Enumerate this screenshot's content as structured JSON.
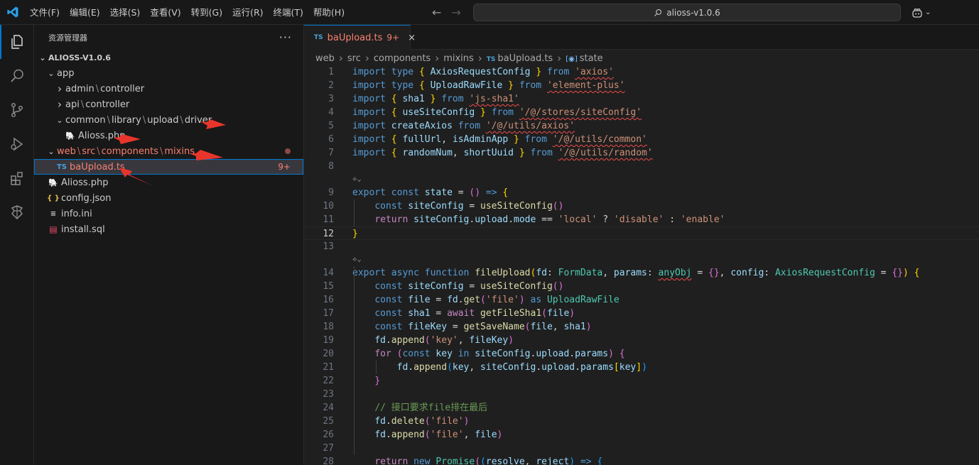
{
  "titlebar": {
    "menu": [
      "文件(F)",
      "编辑(E)",
      "选择(S)",
      "查看(V)",
      "转到(G)",
      "运行(R)",
      "终端(T)",
      "帮助(H)"
    ],
    "search_text": "alioss-v1.0.6"
  },
  "sidebar": {
    "title": "资源管理器",
    "more": "···",
    "root": "ALIOSS-V1.0.6",
    "tree": [
      {
        "depth": 1,
        "chevron": "v",
        "parts": [
          "app"
        ]
      },
      {
        "depth": 2,
        "chevron": ">",
        "parts": [
          "admin",
          "controller"
        ]
      },
      {
        "depth": 2,
        "chevron": ">",
        "parts": [
          "api",
          "controller"
        ]
      },
      {
        "depth": 2,
        "chevron": "v",
        "parts": [
          "common",
          "library",
          "upload",
          "driver"
        ]
      },
      {
        "depth": 3,
        "icon": "php",
        "parts": [
          "Alioss.php"
        ]
      },
      {
        "depth": 1,
        "chevron": "v",
        "parts": [
          "web",
          "src",
          "components",
          "mixins"
        ],
        "red": true,
        "dot": true
      },
      {
        "depth": 2,
        "icon": "ts",
        "parts": [
          "baUpload.ts"
        ],
        "red": true,
        "badge": "9+",
        "selected": true
      },
      {
        "depth": 1,
        "icon": "php",
        "parts": [
          "Alioss.php"
        ]
      },
      {
        "depth": 1,
        "icon": "json",
        "parts": [
          "config.json"
        ]
      },
      {
        "depth": 1,
        "icon": "ini",
        "parts": [
          "info.ini"
        ]
      },
      {
        "depth": 1,
        "icon": "sql",
        "parts": [
          "install.sql"
        ]
      }
    ]
  },
  "editor": {
    "tab": {
      "icon_text": "TS",
      "label": "baUpload.ts",
      "count": "9+",
      "close": "×"
    },
    "breadcrumb": [
      "web",
      "src",
      "components",
      "mixins"
    ],
    "breadcrumb_file": "baUpload.ts",
    "breadcrumb_file_icon": "TS",
    "breadcrumb_symbol": "state",
    "lines": [
      {
        "n": "1",
        "t": [
          [
            "kw",
            "import "
          ],
          [
            "kw",
            "type "
          ],
          [
            "b1",
            "{ "
          ],
          [
            "vr",
            "AxiosRequestConfig "
          ],
          [
            "b1",
            "} "
          ],
          [
            "kw",
            "from "
          ],
          [
            "st~",
            "'axios'"
          ]
        ]
      },
      {
        "n": "2",
        "t": [
          [
            "kw",
            "import "
          ],
          [
            "kw",
            "type "
          ],
          [
            "b1",
            "{ "
          ],
          [
            "vr",
            "UploadRawFile "
          ],
          [
            "b1",
            "} "
          ],
          [
            "kw",
            "from "
          ],
          [
            "st~",
            "'element-plus'"
          ]
        ]
      },
      {
        "n": "3",
        "t": [
          [
            "kw",
            "import "
          ],
          [
            "b1",
            "{ "
          ],
          [
            "vr",
            "sha1 "
          ],
          [
            "b1",
            "} "
          ],
          [
            "kw",
            "from "
          ],
          [
            "st~",
            "'js-sha1'"
          ]
        ]
      },
      {
        "n": "4",
        "t": [
          [
            "kw",
            "import "
          ],
          [
            "b1",
            "{ "
          ],
          [
            "vr",
            "useSiteConfig "
          ],
          [
            "b1",
            "} "
          ],
          [
            "kw",
            "from "
          ],
          [
            "st~",
            "'/@/stores/siteConfig'"
          ]
        ]
      },
      {
        "n": "5",
        "t": [
          [
            "kw",
            "import "
          ],
          [
            "vr",
            "createAxios "
          ],
          [
            "kw",
            "from "
          ],
          [
            "st~",
            "'/@/utils/axios'"
          ]
        ]
      },
      {
        "n": "6",
        "t": [
          [
            "kw",
            "import "
          ],
          [
            "b1",
            "{ "
          ],
          [
            "vr",
            "fullUrl"
          ],
          [
            "pl",
            ", "
          ],
          [
            "vr",
            "isAdminApp "
          ],
          [
            "b1",
            "} "
          ],
          [
            "kw",
            "from "
          ],
          [
            "st~",
            "'/@/utils/common'"
          ]
        ]
      },
      {
        "n": "7",
        "t": [
          [
            "kw",
            "import "
          ],
          [
            "b1",
            "{ "
          ],
          [
            "vr",
            "randomNum"
          ],
          [
            "pl",
            ", "
          ],
          [
            "vr",
            "shortUuid "
          ],
          [
            "b1",
            "} "
          ],
          [
            "kw",
            "from "
          ],
          [
            "st~",
            "'/@/utils/random'"
          ]
        ]
      },
      {
        "n": "8",
        "t": []
      },
      {
        "n": "9",
        "t": [
          [
            "kw",
            "export "
          ],
          [
            "kw",
            "const "
          ],
          [
            "vr",
            "state "
          ],
          [
            "pl",
            "= "
          ],
          [
            "b2",
            "() "
          ],
          [
            "kw",
            "=> "
          ],
          [
            "b1",
            "{"
          ]
        ],
        "lens": true
      },
      {
        "n": "10",
        "t": [
          [
            "pl",
            "    "
          ],
          [
            "kw",
            "const "
          ],
          [
            "vr",
            "siteConfig "
          ],
          [
            "pl",
            "= "
          ],
          [
            "fn",
            "useSiteConfig"
          ],
          [
            "b2",
            "()"
          ]
        ]
      },
      {
        "n": "11",
        "t": [
          [
            "pl",
            "    "
          ],
          [
            "ck",
            "return "
          ],
          [
            "vr",
            "siteConfig"
          ],
          [
            "pl",
            "."
          ],
          [
            "vr",
            "upload"
          ],
          [
            "pl",
            "."
          ],
          [
            "vr",
            "mode "
          ],
          [
            "pl",
            "== "
          ],
          [
            "st",
            "'local' "
          ],
          [
            "pl",
            "? "
          ],
          [
            "st",
            "'disable' "
          ],
          [
            "pl",
            ": "
          ],
          [
            "st",
            "'enable'"
          ]
        ]
      },
      {
        "n": "12",
        "t": [
          [
            "b1",
            "}"
          ]
        ],
        "current": true
      },
      {
        "n": "13",
        "t": []
      },
      {
        "n": "14",
        "t": [
          [
            "kw",
            "export "
          ],
          [
            "kw",
            "async "
          ],
          [
            "kw",
            "function "
          ],
          [
            "fn",
            "fileUpload"
          ],
          [
            "b1",
            "("
          ],
          [
            "vr",
            "fd"
          ],
          [
            "pl",
            ": "
          ],
          [
            "ty",
            "FormData"
          ],
          [
            "pl",
            ", "
          ],
          [
            "vr",
            "params"
          ],
          [
            "pl",
            ": "
          ],
          [
            "ty~",
            "anyObj"
          ],
          [
            "pl",
            " = "
          ],
          [
            "b2",
            "{}"
          ],
          [
            "pl",
            ", "
          ],
          [
            "vr",
            "config"
          ],
          [
            "pl",
            ": "
          ],
          [
            "ty",
            "AxiosRequestConfig "
          ],
          [
            "pl",
            "= "
          ],
          [
            "b2",
            "{}"
          ],
          [
            "b1",
            ")"
          ],
          [
            "pl",
            " "
          ],
          [
            "b1",
            "{"
          ]
        ],
        "lens": true
      },
      {
        "n": "15",
        "t": [
          [
            "pl",
            "    "
          ],
          [
            "kw",
            "const "
          ],
          [
            "vr",
            "siteConfig "
          ],
          [
            "pl",
            "= "
          ],
          [
            "fn",
            "useSiteConfig"
          ],
          [
            "b2",
            "()"
          ]
        ]
      },
      {
        "n": "16",
        "t": [
          [
            "pl",
            "    "
          ],
          [
            "kw",
            "const "
          ],
          [
            "vr",
            "file "
          ],
          [
            "pl",
            "= "
          ],
          [
            "vr",
            "fd"
          ],
          [
            "pl",
            "."
          ],
          [
            "fn",
            "get"
          ],
          [
            "b2",
            "("
          ],
          [
            "st",
            "'file'"
          ],
          [
            "b2",
            ") "
          ],
          [
            "kw",
            "as "
          ],
          [
            "ty",
            "UploadRawFile"
          ]
        ]
      },
      {
        "n": "17",
        "t": [
          [
            "pl",
            "    "
          ],
          [
            "kw",
            "const "
          ],
          [
            "vr",
            "sha1 "
          ],
          [
            "pl",
            "= "
          ],
          [
            "ck",
            "await "
          ],
          [
            "fn",
            "getFileSha1"
          ],
          [
            "b2",
            "("
          ],
          [
            "vr",
            "file"
          ],
          [
            "b2",
            ")"
          ]
        ]
      },
      {
        "n": "18",
        "t": [
          [
            "pl",
            "    "
          ],
          [
            "kw",
            "const "
          ],
          [
            "vr",
            "fileKey "
          ],
          [
            "pl",
            "= "
          ],
          [
            "fn",
            "getSaveName"
          ],
          [
            "b2",
            "("
          ],
          [
            "vr",
            "file"
          ],
          [
            "pl",
            ", "
          ],
          [
            "vr",
            "sha1"
          ],
          [
            "b2",
            ")"
          ]
        ]
      },
      {
        "n": "19",
        "t": [
          [
            "pl",
            "    "
          ],
          [
            "vr",
            "fd"
          ],
          [
            "pl",
            "."
          ],
          [
            "fn",
            "append"
          ],
          [
            "b2",
            "("
          ],
          [
            "st",
            "'key'"
          ],
          [
            "pl",
            ", "
          ],
          [
            "vr",
            "fileKey"
          ],
          [
            "b2",
            ")"
          ]
        ]
      },
      {
        "n": "20",
        "t": [
          [
            "pl",
            "    "
          ],
          [
            "ck",
            "for "
          ],
          [
            "b2",
            "("
          ],
          [
            "kw",
            "const "
          ],
          [
            "vr",
            "key "
          ],
          [
            "kw",
            "in "
          ],
          [
            "vr",
            "siteConfig"
          ],
          [
            "pl",
            "."
          ],
          [
            "vr",
            "upload"
          ],
          [
            "pl",
            "."
          ],
          [
            "vr",
            "params"
          ],
          [
            "b2",
            ") "
          ],
          [
            "b2",
            "{"
          ]
        ]
      },
      {
        "n": "21",
        "t": [
          [
            "pl",
            "        "
          ],
          [
            "vr",
            "fd"
          ],
          [
            "pl",
            "."
          ],
          [
            "fn",
            "append"
          ],
          [
            "b3",
            "("
          ],
          [
            "vr",
            "key"
          ],
          [
            "pl",
            ", "
          ],
          [
            "vr",
            "siteConfig"
          ],
          [
            "pl",
            "."
          ],
          [
            "vr",
            "upload"
          ],
          [
            "pl",
            "."
          ],
          [
            "vr",
            "params"
          ],
          [
            "b1",
            "["
          ],
          [
            "vr",
            "key"
          ],
          [
            "b1",
            "]"
          ],
          [
            "b3",
            ")"
          ]
        ]
      },
      {
        "n": "22",
        "t": [
          [
            "pl",
            "    "
          ],
          [
            "b2",
            "}"
          ]
        ]
      },
      {
        "n": "23",
        "t": []
      },
      {
        "n": "24",
        "t": [
          [
            "pl",
            "    "
          ],
          [
            "cm",
            "// 接口要求file排在最后"
          ]
        ]
      },
      {
        "n": "25",
        "t": [
          [
            "pl",
            "    "
          ],
          [
            "vr",
            "fd"
          ],
          [
            "pl",
            "."
          ],
          [
            "fn",
            "delete"
          ],
          [
            "b2",
            "("
          ],
          [
            "st",
            "'file'"
          ],
          [
            "b2",
            ")"
          ]
        ]
      },
      {
        "n": "26",
        "t": [
          [
            "pl",
            "    "
          ],
          [
            "vr",
            "fd"
          ],
          [
            "pl",
            "."
          ],
          [
            "fn",
            "append"
          ],
          [
            "b2",
            "("
          ],
          [
            "st",
            "'file'"
          ],
          [
            "pl",
            ", "
          ],
          [
            "vr",
            "file"
          ],
          [
            "b2",
            ")"
          ]
        ]
      },
      {
        "n": "27",
        "t": []
      },
      {
        "n": "28",
        "t": [
          [
            "pl",
            "    "
          ],
          [
            "ck",
            "return "
          ],
          [
            "kw",
            "new "
          ],
          [
            "ty",
            "Promise"
          ],
          [
            "b2",
            "("
          ],
          [
            "b3",
            "("
          ],
          [
            "vr",
            "resolve"
          ],
          [
            "pl",
            ", "
          ],
          [
            "vr",
            "reject"
          ],
          [
            "b3",
            ") "
          ],
          [
            "kw",
            "=> "
          ],
          [
            "b3",
            "{"
          ]
        ]
      }
    ]
  },
  "colors": {
    "accent": "#0078d4",
    "error": "#f88070",
    "annotation_arrow": "#e8352b"
  }
}
